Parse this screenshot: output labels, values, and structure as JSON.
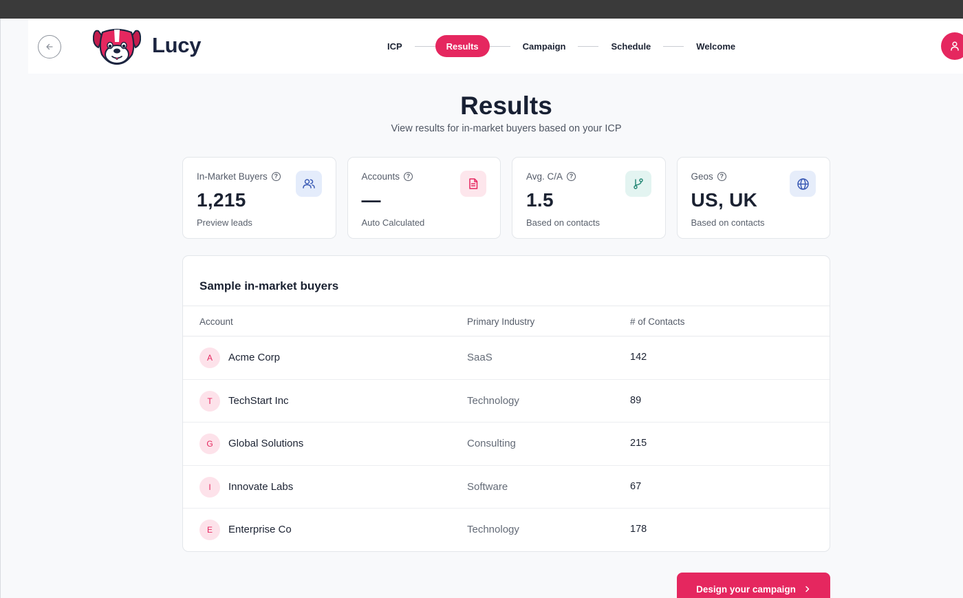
{
  "app": {
    "brand": "Lucy"
  },
  "stepper": {
    "steps": [
      {
        "label": "ICP"
      },
      {
        "label": "Results"
      },
      {
        "label": "Campaign"
      },
      {
        "label": "Schedule"
      },
      {
        "label": "Welcome"
      }
    ],
    "active": "Results"
  },
  "page": {
    "title": "Results",
    "subtitle": "View results for in-market buyers based on your ICP"
  },
  "stats": [
    {
      "label": "In-Market Buyers",
      "value": "1,215",
      "note": "Preview leads",
      "icon": "users-icon",
      "icon_bg": "#e4ecfb",
      "icon_color": "#3b5bb5"
    },
    {
      "label": "Accounts",
      "value": "—",
      "note": "Auto Calculated",
      "icon": "document-icon",
      "icon_bg": "#fde6ec",
      "icon_color": "#e5275f"
    },
    {
      "label": "Avg. C/A",
      "value": "1.5",
      "note": "Based on contacts",
      "icon": "branch-icon",
      "icon_bg": "#e3f4f1",
      "icon_color": "#2a8a78"
    },
    {
      "label": "Geos",
      "value": "US, UK",
      "note": "Based on contacts",
      "icon": "globe-icon",
      "icon_bg": "#e6edfa",
      "icon_color": "#3b5bb5"
    }
  ],
  "table": {
    "title": "Sample in-market buyers",
    "columns": [
      "Account",
      "Primary Industry",
      "# of Contacts"
    ],
    "rows": [
      {
        "initial": "A",
        "account": "Acme Corp",
        "industry": "SaaS",
        "contacts": "142"
      },
      {
        "initial": "T",
        "account": "TechStart Inc",
        "industry": "Technology",
        "contacts": "89"
      },
      {
        "initial": "G",
        "account": "Global Solutions",
        "industry": "Consulting",
        "contacts": "215"
      },
      {
        "initial": "I",
        "account": "Innovate Labs",
        "industry": "Software",
        "contacts": "67"
      },
      {
        "initial": "E",
        "account": "Enterprise Co",
        "industry": "Technology",
        "contacts": "178"
      }
    ]
  },
  "cta": {
    "label": "Design your campaign"
  },
  "colors": {
    "accent": "#e5275f",
    "text": "#1b2232",
    "muted": "#545b68"
  }
}
